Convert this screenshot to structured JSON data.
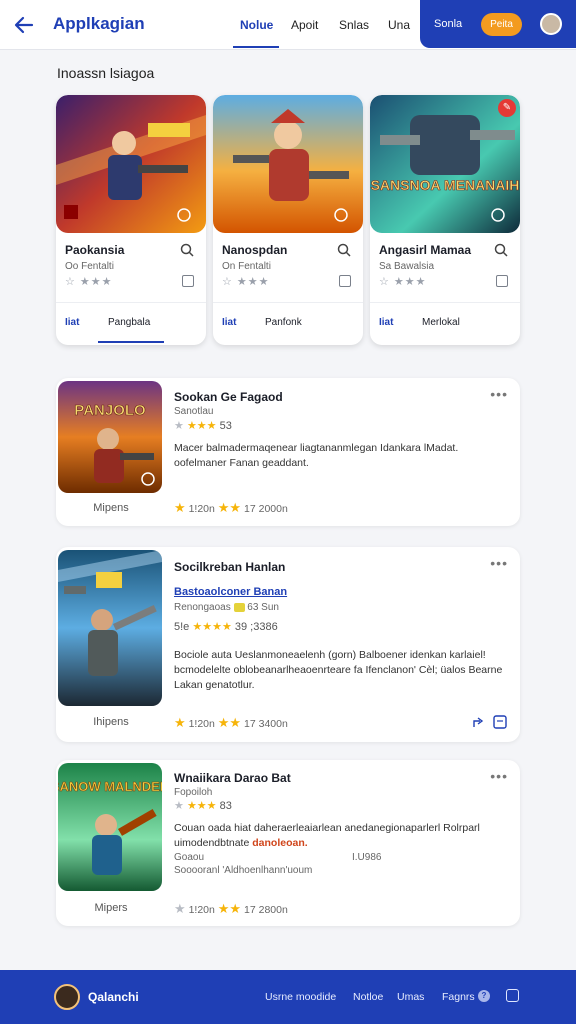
{
  "header": {
    "title": "Applkagian",
    "tabs": [
      "Nolue",
      "Apoit",
      "Snlas",
      "Una"
    ],
    "active_tab": "Nolue",
    "right_link": "Sonla",
    "right_button": "Peita"
  },
  "section_title": "Inoassn lsiagoa",
  "featured": [
    {
      "title": "Paokansia",
      "sub": "Oo Fentalti",
      "tab1": "Iiat",
      "tab2": "Pangbala",
      "art_text": ""
    },
    {
      "title": "Nanospdan",
      "sub": "On Fentalti",
      "tab1": "Iiat",
      "tab2": "Panfonk",
      "art_text": ""
    },
    {
      "title": "Angasirl Mamaa",
      "sub": "Sa Bawalsia",
      "tab1": "Iiat",
      "tab2": "Merlokal",
      "art_text": "SANSNOA MENANAIH"
    }
  ],
  "list": [
    {
      "title": "Sookan Ge Fagaod",
      "sub": "Sanotlau",
      "rating_text": "53",
      "desc": "Macer balmadermaqenear liagtananmlegan Idankara lMadat. oofelmaner Fanan geaddant.",
      "caption": "Mipens",
      "footer_left": "1!20n",
      "footer_right": "17 2000n",
      "art_text": "PANJOLO"
    },
    {
      "title": "Socilkreban Hanlan",
      "link": "Bastoaolconer Banan",
      "sub": "Renongaoas",
      "sub2": "63 Sun",
      "rating_prefix": "5!e",
      "rating_text": "39 ;3386",
      "desc": "Bociole auta Ueslanmoneaelenh (gorn) Balboener idenkan karlaiel! bcmodelelte oblobeanarlheaoenrteare fa Ifenclanon' Cèl; üalos Bearne Lakan genatotlur.",
      "caption": "Ihipens",
      "footer_left": "1!20n",
      "footer_right": "17 3400n"
    },
    {
      "title": "Wnaiikara Darao Bat",
      "sub": "Fopoiloh",
      "rating_text": "83",
      "desc": "Couan oada hiat daheraerleaiarlean anedanegionaparlerl Rolrparl uimodendbtnate ",
      "desc_highlight": "danoleoan.",
      "extra_left": "Goaou",
      "extra_right": "I.U986",
      "extra_line": "Sooooranl 'Aldhoenlhann'uoum",
      "caption": "Mipers",
      "footer_left": "1!20n",
      "footer_right": "17 2800n",
      "art_text": "SANOW MALNDER"
    }
  ],
  "bottom": {
    "name": "Qalanchi",
    "links": [
      "Usrne moodide",
      "Notloe",
      "Umas",
      "Fagnrs"
    ]
  },
  "colors": {
    "brand": "#1f3fb5",
    "accent": "#f39b1f",
    "star": "#f6b40a"
  }
}
